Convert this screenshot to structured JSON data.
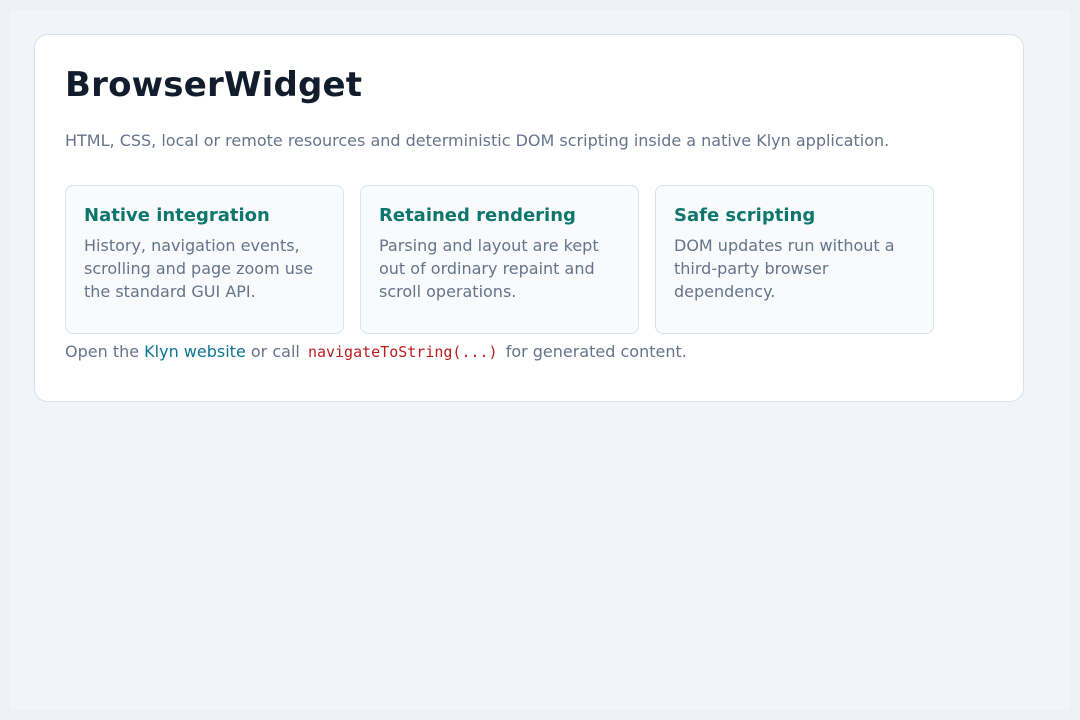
{
  "page": {
    "title": "BrowserWidget",
    "subtitle": "HTML, CSS, local or remote resources and deterministic DOM scripting inside a native Klyn application."
  },
  "features": [
    {
      "title": "Native integration",
      "description": "History, navigation events, scrolling and page zoom use the standard GUI API."
    },
    {
      "title": "Retained rendering",
      "description": "Parsing and layout are kept out of ordinary repaint and scroll operations."
    },
    {
      "title": "Safe scripting",
      "description": "DOM updates run without a third-party browser dependency."
    }
  ],
  "footer": {
    "prefix": "Open the",
    "link_text": "Klyn website",
    "middle": "or call",
    "code": "navigateToString(...)",
    "suffix": "for generated content."
  },
  "colors": {
    "background": "#f1f4f8",
    "card": "#ffffff",
    "title": "#111c2d",
    "accent": "#0f766e",
    "link": "#0e7490",
    "code": "#b91c1c",
    "muted": "#64748b"
  }
}
